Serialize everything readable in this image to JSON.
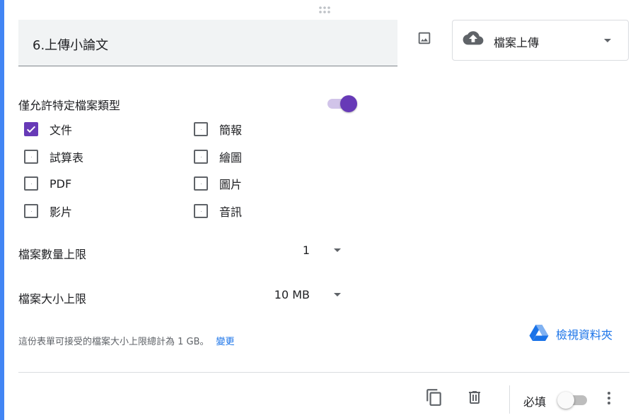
{
  "question": {
    "title": "6.上傳小論文",
    "type_select": {
      "value": "檔案上傳",
      "icon": "cloud-upload-icon"
    }
  },
  "file_types": {
    "label": "僅允許特定檔案類型",
    "toggle_on": true,
    "options": [
      {
        "label": "文件",
        "checked": true
      },
      {
        "label": "簡報",
        "checked": false
      },
      {
        "label": "試算表",
        "checked": false
      },
      {
        "label": "繪圖",
        "checked": false
      },
      {
        "label": "PDF",
        "checked": false
      },
      {
        "label": "圖片",
        "checked": false
      },
      {
        "label": "影片",
        "checked": false
      },
      {
        "label": "音訊",
        "checked": false
      }
    ]
  },
  "max_files": {
    "label": "檔案數量上限",
    "value": "1"
  },
  "max_size": {
    "label": "檔案大小上限",
    "value": "10 MB"
  },
  "note": {
    "text": "這份表單可接受的檔案大小上限總計為 1 GB。",
    "link": "變更"
  },
  "drive_link": {
    "label": "檢視資料夾",
    "icon": "google-drive-icon"
  },
  "footer": {
    "required_label": "必填",
    "required_on": false
  },
  "colors": {
    "accent": "#673ab7",
    "accent_light": "#d1c4e9",
    "link": "#1a73e8",
    "left_bar": "#4285f4"
  }
}
